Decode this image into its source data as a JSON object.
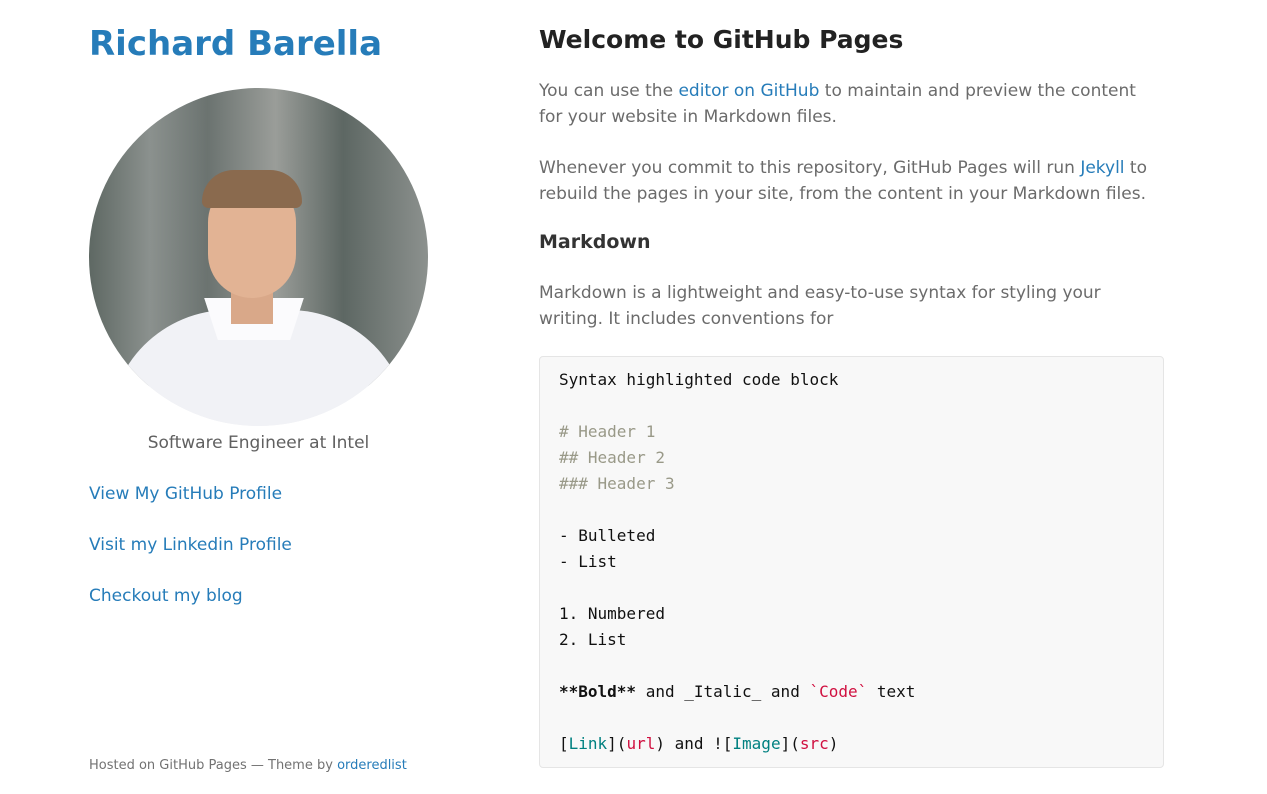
{
  "sidebar": {
    "title": "Richard Barella",
    "tagline": "Software Engineer at Intel",
    "links": [
      {
        "label": "View My GitHub Profile"
      },
      {
        "label": "Visit my Linkedin Profile"
      },
      {
        "label": "Checkout my blog"
      }
    ],
    "footer": {
      "prefix": "Hosted on GitHub Pages — Theme by ",
      "theme_link": "orderedlist"
    }
  },
  "main": {
    "heading": "Welcome to GitHub Pages",
    "p1": {
      "before": "You can use the ",
      "link": "editor on GitHub",
      "after": " to maintain and preview the content for your website in Markdown files."
    },
    "p2": {
      "before": "Whenever you commit to this repository, GitHub Pages will run ",
      "link": "Jekyll",
      "after": " to rebuild the pages in your site, from the content in your Markdown files."
    },
    "subheading": "Markdown",
    "p3": "Markdown is a lightweight and easy-to-use syntax for styling your writing. It includes conventions for",
    "code": {
      "line1": "Syntax highlighted code block",
      "h1": "# Header 1",
      "h2": "## Header 2",
      "h3": "### Header 3",
      "bullet1": "- Bulleted",
      "bullet2": "- List",
      "num1": "1. Numbered",
      "num2": "2. List",
      "bold": "**Bold**",
      "mid1": " and _Italic_ and ",
      "code_tok": "`Code`",
      "end1": " text",
      "lb1": "[",
      "link_word": "Link",
      "lb2": "](",
      "url_word": "url",
      "lb3": ") and ![",
      "image_word": "Image",
      "lb4": "](",
      "src_word": "src",
      "lb5": ")"
    }
  },
  "colors": {
    "link": "#267CB9",
    "heading": "#222222",
    "code_comment": "#999988",
    "code_string": "#d01040",
    "code_teal": "#008080"
  }
}
